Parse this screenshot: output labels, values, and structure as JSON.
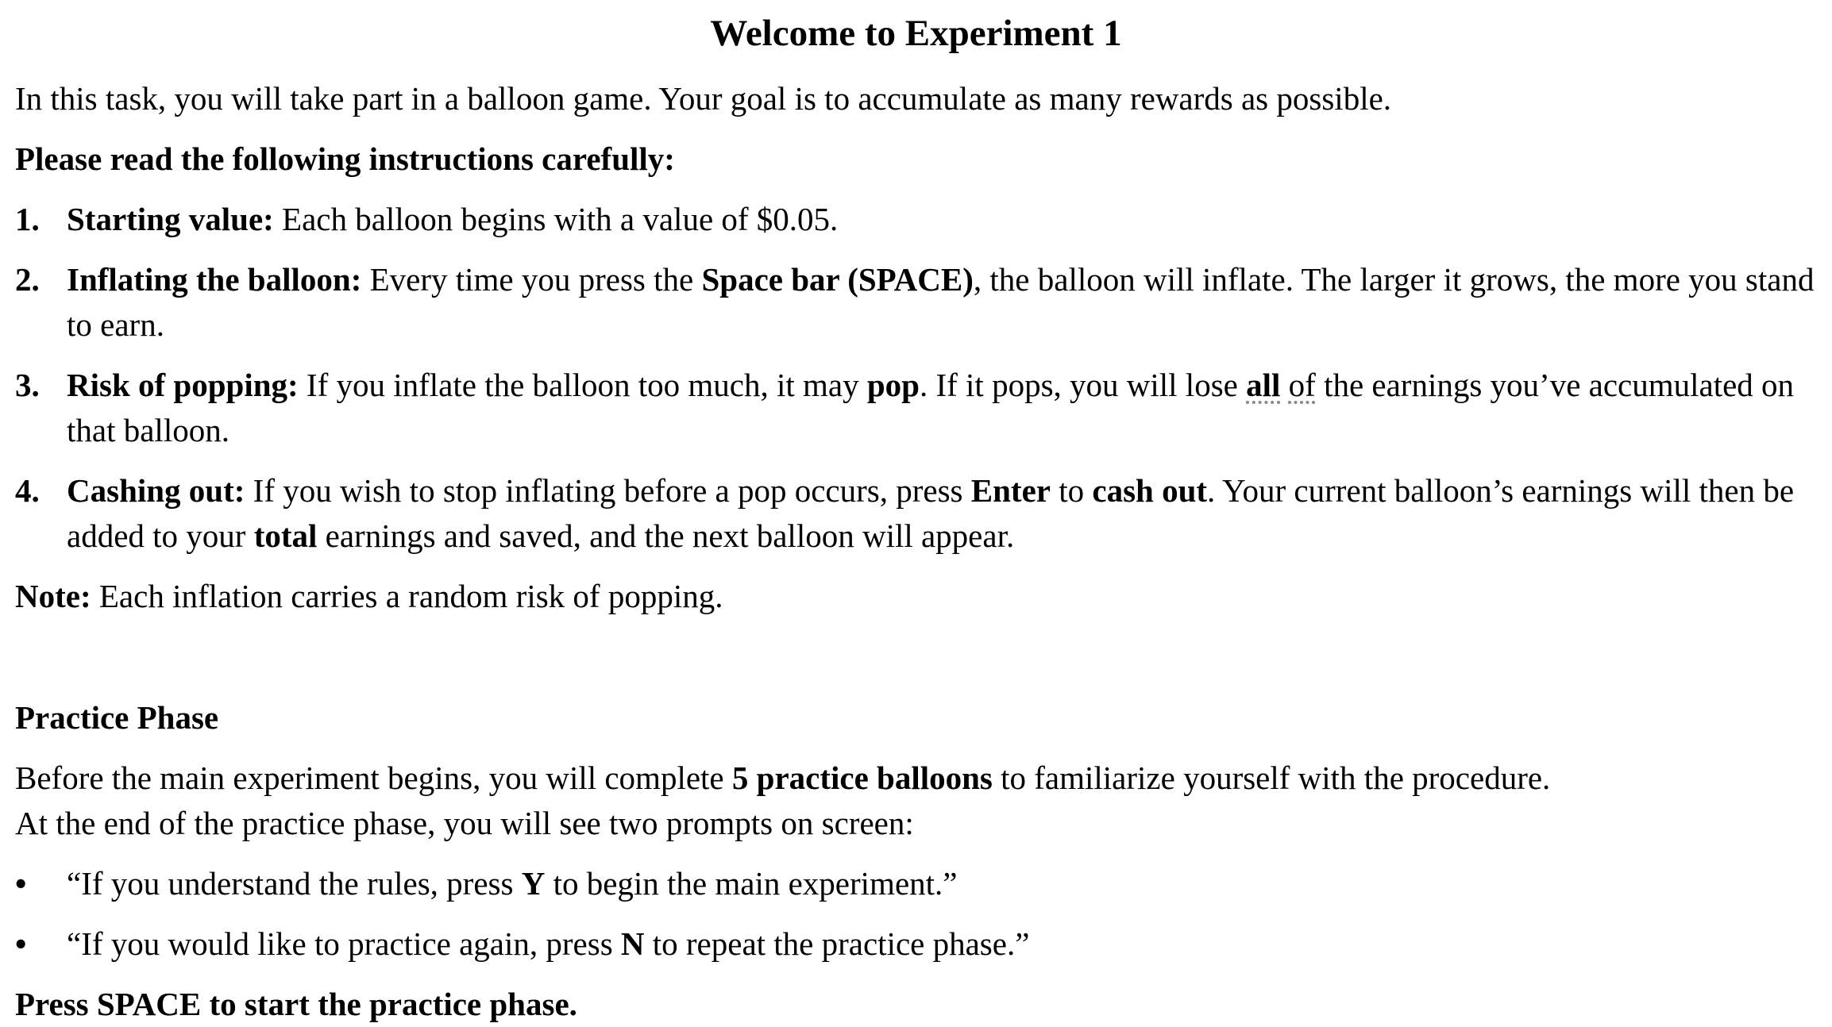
{
  "title": "Welcome to Experiment 1",
  "intro": "In this task, you will take part in a balloon game. Your goal is to accumulate as many rewards as possible.",
  "instructions_heading": "Please read the following instructions carefully:",
  "rules": [
    {
      "number": "1.",
      "label": "Starting value:",
      "text": " Each balloon begins with a value of $0.05."
    },
    {
      "number": "2.",
      "label": "Inflating the balloon:",
      "t1": " Every time you press the ",
      "key": "Space bar (SPACE)",
      "t2": ", the balloon will inflate. The larger it grows, the more you stand to earn."
    },
    {
      "number": "3.",
      "label": "Risk of popping:",
      "t1": " If you inflate the balloon too much, it may ",
      "pop": "pop",
      "t2": ". If it pops, you will lose ",
      "all": "all",
      "space": " ",
      "of": "of",
      "t3": " the earnings you’ve accumulated on that balloon."
    },
    {
      "number": "4.",
      "label": "Cashing out:",
      "t1": " If you wish to stop inflating before a pop occurs, press ",
      "enter": "Enter",
      "t2": " to ",
      "cash_out": "cash out",
      "t3": ". Your current balloon’s earnings will then be added to your ",
      "total": "total",
      "t4": " earnings and saved, and the next balloon will appear."
    }
  ],
  "note": {
    "label": "Note:",
    "text": " Each inflation carries a random risk of popping."
  },
  "practice": {
    "heading": "Practice Phase",
    "p1_t1": "Before the main experiment begins, you will complete ",
    "p1_bold": "5 practice balloons",
    "p1_t2": " to familiarize yourself with the procedure.",
    "p2": "At the end of the practice phase, you will see two prompts on screen:",
    "bullets": [
      {
        "marker": "•",
        "t1": "“If you understand the rules, press ",
        "key": "Y",
        "t2": " to begin the main experiment.”"
      },
      {
        "marker": "•",
        "t1": "“If you would like to practice again, press ",
        "key": "N",
        "t2": " to repeat the practice phase.”"
      }
    ],
    "start_prompt": "Press SPACE to start the practice phase."
  }
}
